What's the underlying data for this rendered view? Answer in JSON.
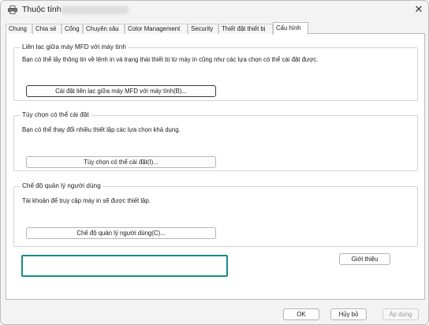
{
  "window": {
    "title": "Thuộc tính",
    "close_glyph": "✕"
  },
  "tabs": [
    {
      "label": "Chung",
      "active": false
    },
    {
      "label": "Chia sẻ",
      "active": false
    },
    {
      "label": "Cổng",
      "active": false
    },
    {
      "label": "Chuyên sâu",
      "active": false
    },
    {
      "label": "Color Management",
      "active": false
    },
    {
      "label": "Security",
      "active": false
    },
    {
      "label": "Thiết đặt thiết bị",
      "active": false
    },
    {
      "label": "Cấu hình",
      "active": true
    }
  ],
  "sections": {
    "mfd": {
      "title": "Liên lạc giữa máy MFD với máy tính",
      "description": "Bạn có thể lấy thông tin về lệnh in và trạng thái thiết bị từ máy in cũng như các lựa chọn có thể cài đặt được.",
      "button": "Cài đặt liên lạc giữa máy MFD với máy tính(B)..."
    },
    "options": {
      "title": "Tùy chọn có thể cài đặt",
      "description": "Bạn có thể thay đổi nhiều thiết lập các lựa chọn khả dụng.",
      "button": "Tùy chọn có thể cài đặt(I)..."
    },
    "user_mode": {
      "title": "Chế độ quản lý người dùng",
      "description": "Tài khoản để truy cập máy in sẽ được thiết lập.",
      "button": "Chế độ quản lý người dùng(C)..."
    }
  },
  "about_button": "Giới thiệu",
  "footer": {
    "ok": "OK",
    "cancel": "Hủy bỏ",
    "apply": "Áp dụng"
  },
  "colors": {
    "highlight": "#188c84"
  }
}
